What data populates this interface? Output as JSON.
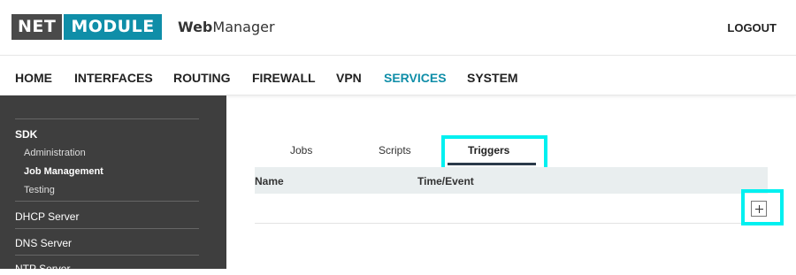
{
  "header": {
    "logo_part1": "NET",
    "logo_part2": "MODULE",
    "app_title_bold": "Web",
    "app_title_rest": "Manager",
    "logout": "LOGOUT"
  },
  "nav": {
    "items": [
      {
        "label": "HOME"
      },
      {
        "label": "INTERFACES"
      },
      {
        "label": "ROUTING"
      },
      {
        "label": "FIREWALL"
      },
      {
        "label": "VPN"
      },
      {
        "label": "SERVICES"
      },
      {
        "label": "SYSTEM"
      }
    ],
    "active": "SERVICES"
  },
  "sidebar": {
    "section": "SDK",
    "sub_items": [
      {
        "label": "Administration"
      },
      {
        "label": "Job Management"
      },
      {
        "label": "Testing"
      }
    ],
    "items": [
      {
        "label": "DHCP Server"
      },
      {
        "label": "DNS Server"
      },
      {
        "label": "NTP Server"
      }
    ]
  },
  "tabs": [
    {
      "label": "Jobs"
    },
    {
      "label": "Scripts"
    },
    {
      "label": "Triggers"
    }
  ],
  "active_tab": "Triggers",
  "table": {
    "columns": [
      "Name",
      "Time/Event"
    ]
  },
  "colors": {
    "brand": "#0f8ea8",
    "sidebar_bg": "#3e3e3e",
    "highlight": "#00f0f0"
  },
  "icons": {
    "add": "plus-icon"
  }
}
